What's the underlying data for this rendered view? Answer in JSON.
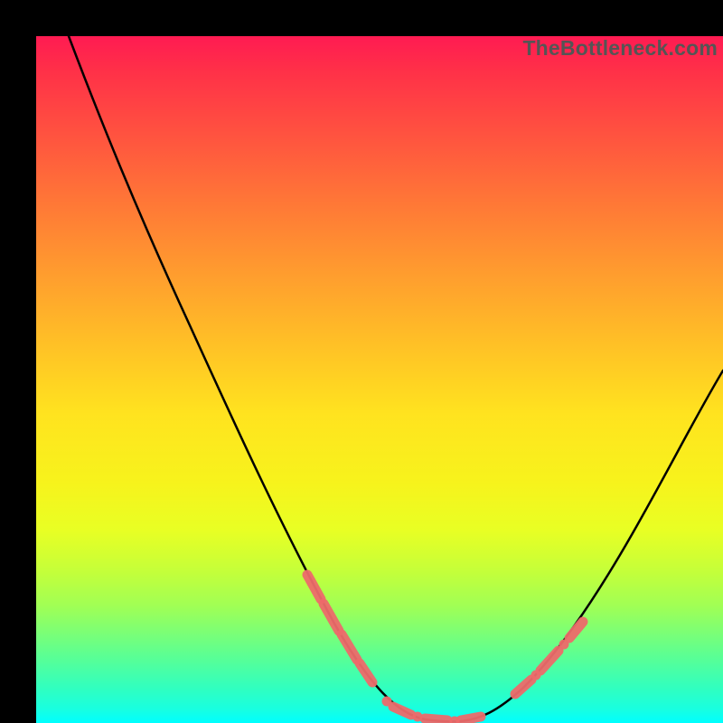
{
  "watermark": "TheBottleneck.com",
  "chart_data": {
    "type": "line",
    "title": "",
    "xlabel": "",
    "ylabel": "",
    "xlim": [
      0,
      100
    ],
    "ylim": [
      0,
      100
    ],
    "note": "Bottleneck curve: y represents bottleneck severity (high = red/top, low = green/bottom). Values estimated from pixel positions; no axis ticks shown.",
    "series": [
      {
        "name": "bottleneck-curve",
        "x": [
          5,
          10,
          15,
          20,
          25,
          30,
          35,
          40,
          45,
          50,
          55,
          58,
          62,
          65,
          70,
          75,
          80,
          85,
          90,
          95,
          100
        ],
        "y": [
          100,
          90,
          80,
          68,
          56,
          44,
          33,
          22,
          13,
          6,
          1,
          0,
          0,
          2,
          8,
          17,
          27,
          37,
          47,
          55,
          60
        ]
      }
    ],
    "highlighted_segments": [
      {
        "name": "left-slope-marks",
        "x_range": [
          38,
          50
        ]
      },
      {
        "name": "trough-marks",
        "x_range": [
          50,
          65
        ]
      },
      {
        "name": "right-slope-marks",
        "x_range": [
          70,
          78
        ]
      }
    ]
  }
}
